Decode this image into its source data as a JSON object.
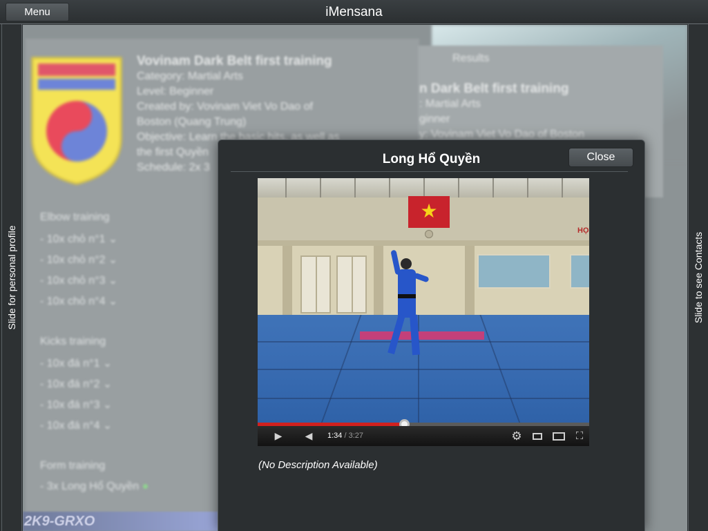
{
  "header": {
    "menu_label": "Menu",
    "title": "iMensana"
  },
  "left_panel": {
    "label": "Slide for personal profile"
  },
  "right_panel": {
    "label": "Slide to see Contacts"
  },
  "background": {
    "course_title": "Vovinam Dark Belt first training",
    "category": "Category: Martial Arts",
    "level": "Level: Beginner",
    "created_by_1": "Created by: Vovinam Viet Vo Dao of",
    "created_by_2": "Boston (Quang Trung)",
    "objective_1": "Objective: Learn the basic hits, as well as",
    "objective_2": "the first Quyền",
    "schedule": "Schedule: 2x 3",
    "results_tab": "Results",
    "right_title": "n Dark Belt first training",
    "right_category": ": Martial Arts",
    "right_level": "ginner",
    "right_created": "y: Vovinam Viet Vo Dao of Boston",
    "sections": [
      {
        "heading": "Elbow training",
        "items": [
          "10x chỏ n°1",
          "10x chỏ n°2",
          "10x chỏ n°3",
          "10x chỏ n°4"
        ]
      },
      {
        "heading": "Kicks training",
        "items": [
          "10x đá n°1",
          "10x đá n°2",
          "10x đá n°3",
          "10x đá n°4"
        ]
      },
      {
        "heading": "Form training",
        "items": [
          "3x Long Hổ Quyền"
        ]
      }
    ],
    "watermark": "2K9-GRXO"
  },
  "modal": {
    "title": "Long Hổ Quyền",
    "close_label": "Close",
    "description": "(No Description Available)"
  },
  "video": {
    "current_time": "1:34",
    "separator": " / ",
    "duration": "3:27",
    "progress_fraction": 0.442
  },
  "colors": {
    "progress": "#d0211f",
    "flag": "#c8232c",
    "mat": "#3a6db3"
  }
}
